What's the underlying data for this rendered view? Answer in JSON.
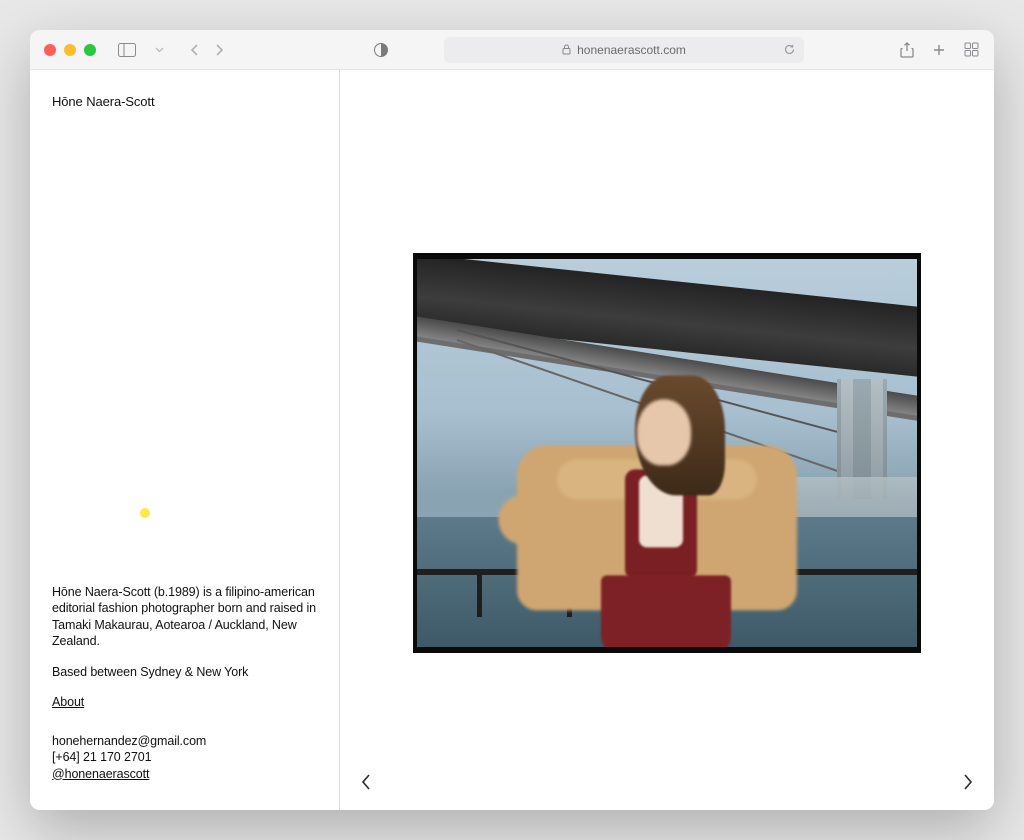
{
  "browser": {
    "url_display": "honenaerascott.com"
  },
  "sidebar": {
    "title": "Hōne Naera-Scott",
    "bio_1": "Hōne Naera-Scott (b.1989) is a filipino-american editorial fashion photographer born and raised in Tamaki Makaurau, Aotearoa / Auckland, New Zealand.",
    "bio_2": "Based between Sydney & New York",
    "about_label": "About",
    "contact": {
      "email": "honehernandez@gmail.com",
      "phone": "[+64] 21 170 2701",
      "instagram": "@honenaerascott"
    }
  }
}
